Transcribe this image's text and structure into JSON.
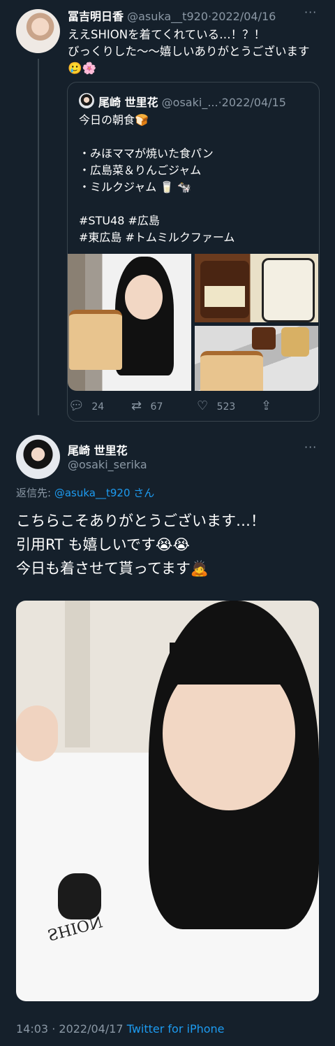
{
  "thread_tweet": {
    "author_name": "冨吉明日香",
    "author_handle": "@asuka__t920",
    "date": "2022/04/16",
    "text": "ええSHIONを着てくれている…！？！\nびっくりした〜〜嬉しいありがとうございます🥲🌸"
  },
  "quoted_tweet": {
    "author_name": "尾崎 世里花",
    "author_handle": "@osaki_...",
    "date": "2022/04/15",
    "lines": [
      "今日の朝食🍞",
      "",
      "・みほママが焼いた食パン",
      "・広島菜＆りんごジャム",
      "・ミルクジャム 🥛 🐄",
      "",
      "#STU48 #広島",
      "#東広島 #トムミルクファーム"
    ]
  },
  "actions": {
    "replies": "24",
    "retweets": "67",
    "likes": "523"
  },
  "main_tweet": {
    "author_name": "尾崎 世里花",
    "author_handle": "@osaki_serika",
    "replying_prefix": "返信先:",
    "replying_to": "@asuka__t920",
    "replying_suffix": "さん",
    "lines": [
      "こちらこそありがとうございます…！",
      "引用RT も嬉しいです😭😭",
      "今日も着させて貰ってます🙇"
    ],
    "photo_print_text": "SHION"
  },
  "meta": {
    "time": "14:03",
    "date": "2022/04/17",
    "source": "Twitter for iPhone"
  },
  "more_label": "···",
  "separator": "·"
}
